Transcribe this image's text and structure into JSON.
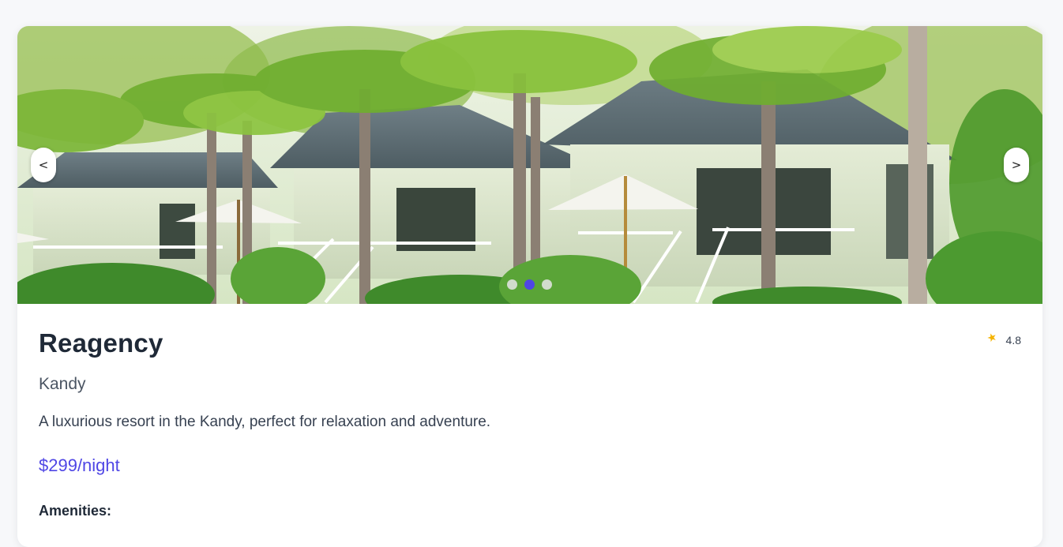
{
  "carousel": {
    "prev_label": "<",
    "next_label": ">",
    "slide_count": 3,
    "active_slide": 2,
    "image_description": "tropical-villas-with-palm-trees"
  },
  "hotel": {
    "name": "Reagency",
    "location": "Kandy",
    "description": "A luxurious resort in the Kandy, perfect for relaxation and adventure.",
    "price": "$299/night",
    "rating": "4.8",
    "rating_icon": "star-icon",
    "amenities_heading": "Amenities:"
  },
  "colors": {
    "accent": "#4f46e5",
    "star": "#f5b301",
    "background": "#f7f8fa"
  }
}
